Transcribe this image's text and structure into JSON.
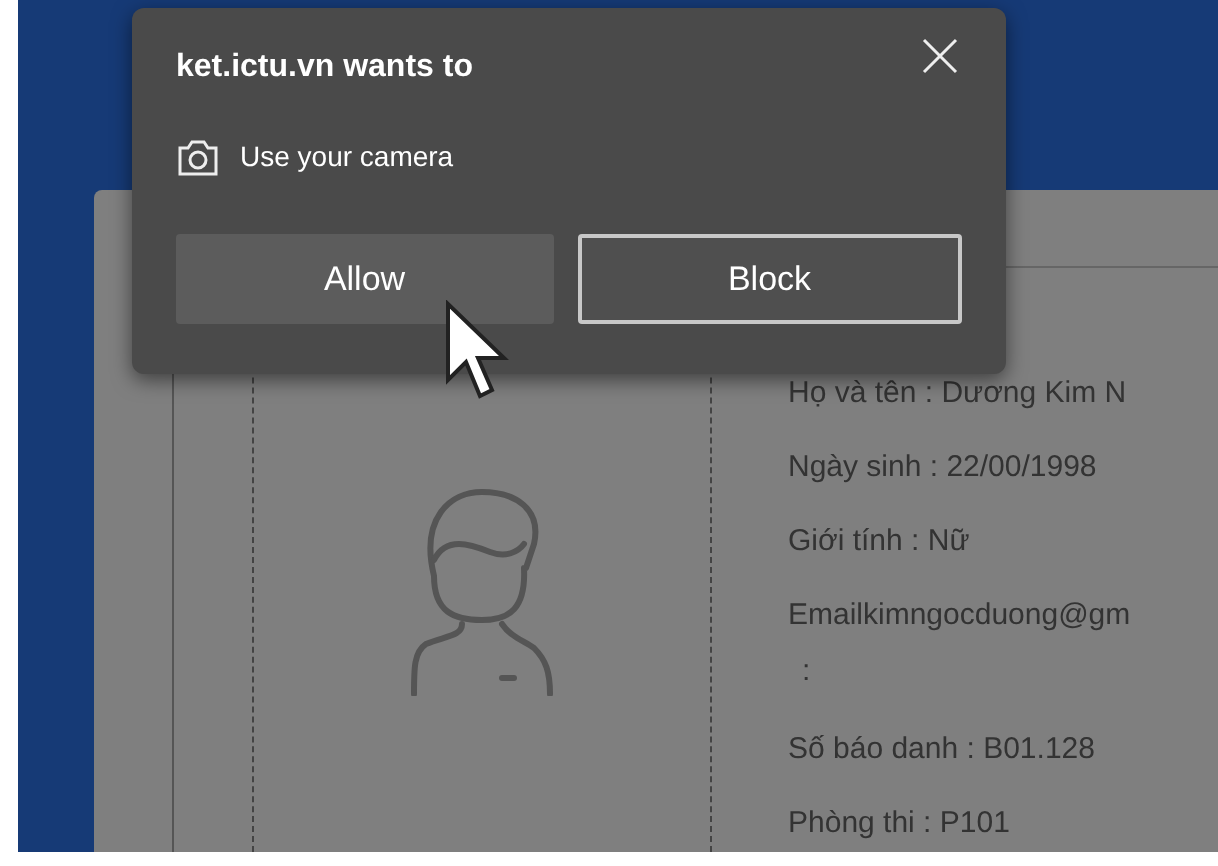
{
  "dialog": {
    "title": "ket.ictu.vn wants to",
    "permission": "Use your camera",
    "buttons": [
      {
        "label": "Allow",
        "kind": "filled"
      },
      {
        "label": "Block",
        "kind": "outlined"
      }
    ]
  },
  "profile": {
    "rows": [
      "Họ và tên : Dương Kim N",
      "Ngày sinh : 22/00/1998",
      "Giới tính : Nữ",
      "Emailkimngocduong@gm",
      ":",
      "Số báo danh : B01.128",
      "Phòng thi : P101"
    ]
  }
}
